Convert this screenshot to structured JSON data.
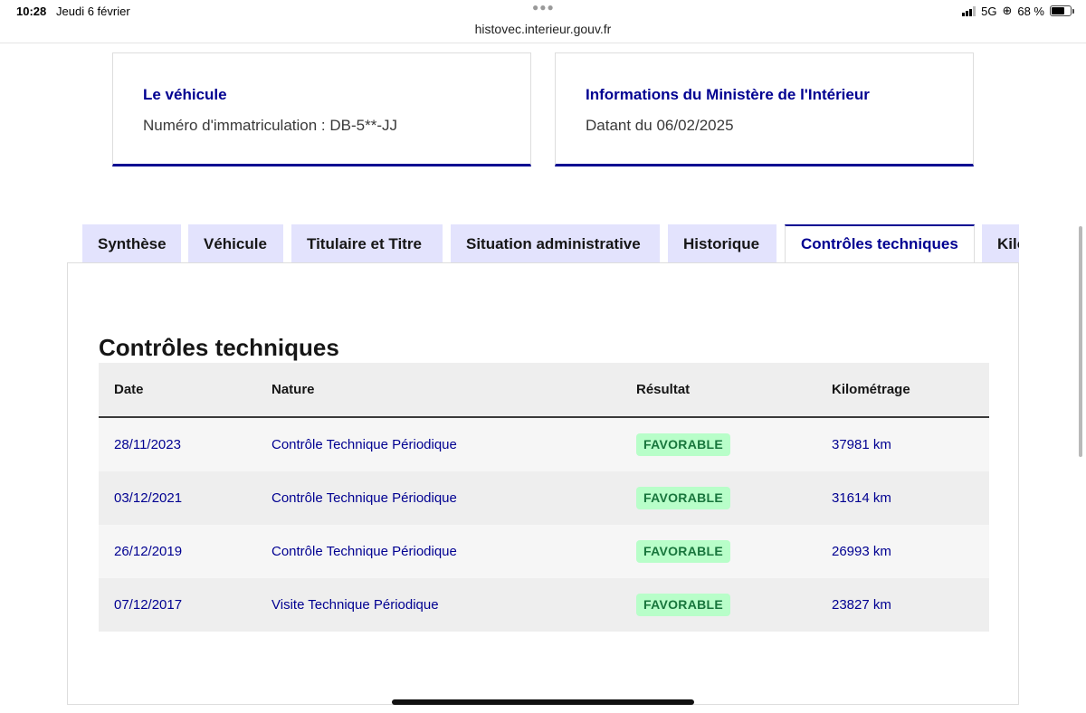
{
  "status_bar": {
    "time": "10:28",
    "date": "Jeudi 6 février",
    "url": "histovec.interieur.gouv.fr",
    "network": "5G",
    "battery": "68 %",
    "battery_level": 0.68
  },
  "cards": {
    "vehicle": {
      "title": "Le véhicule",
      "text": "Numéro d'immatriculation : DB-5**-JJ"
    },
    "ministry": {
      "title": "Informations du Ministère de l'Intérieur",
      "text": "Datant du 06/02/2025"
    }
  },
  "tabs": [
    {
      "label": "Synthèse",
      "active": false
    },
    {
      "label": "Véhicule",
      "active": false
    },
    {
      "label": "Titulaire et Titre",
      "active": false
    },
    {
      "label": "Situation administrative",
      "active": false
    },
    {
      "label": "Historique",
      "active": false
    },
    {
      "label": "Contrôles techniques",
      "active": true
    },
    {
      "label": "Kilo",
      "active": false
    }
  ],
  "section": {
    "title": "Contrôles techniques",
    "columns": [
      "Date",
      "Nature",
      "Résultat",
      "Kilométrage"
    ],
    "rows": [
      {
        "date": "28/11/2023",
        "nature": "Contrôle Technique Périodique",
        "result": "FAVORABLE",
        "mileage": "37981 km"
      },
      {
        "date": "03/12/2021",
        "nature": "Contrôle Technique Périodique",
        "result": "FAVORABLE",
        "mileage": "31614 km"
      },
      {
        "date": "26/12/2019",
        "nature": "Contrôle Technique Périodique",
        "result": "FAVORABLE",
        "mileage": "26993 km"
      },
      {
        "date": "07/12/2017",
        "nature": "Visite Technique Périodique",
        "result": "FAVORABLE",
        "mileage": "23827 km"
      }
    ]
  },
  "colors": {
    "primary": "#000091",
    "tab_bg": "#e3e3fd",
    "badge_bg": "#b8fec9",
    "badge_text": "#18753c"
  }
}
